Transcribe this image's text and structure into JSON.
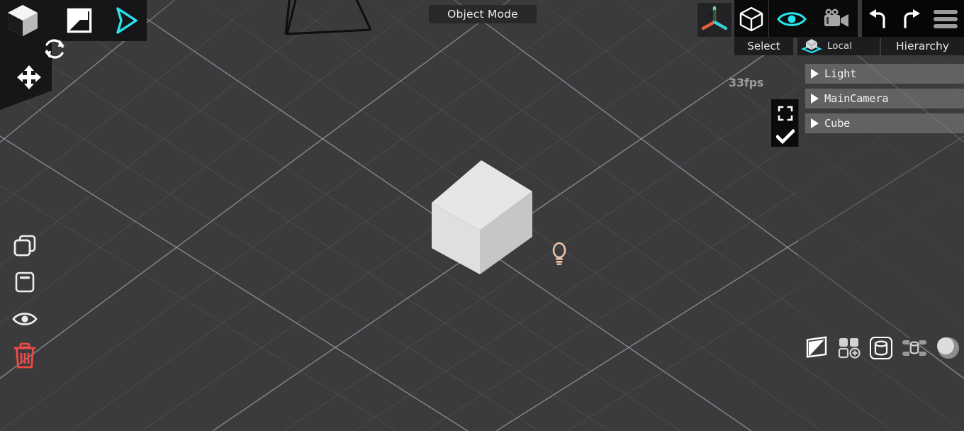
{
  "app": {
    "mode_label": "Object Mode",
    "fps": "33fps"
  },
  "colors": {
    "viewport_bg": "#3b3b3d",
    "grid_line": "#8c8c90",
    "panel_dark": "#161618",
    "accent_cyan": "#28e4ef",
    "danger_red": "#f04a46",
    "light_gizmo": "#f0c0a8",
    "axis_x": "#e2603a",
    "axis_y": "#6fd98a",
    "axis_z": "#35cfd6"
  },
  "top_left_toolbar": {
    "items": [
      {
        "name": "cube-3d-icon",
        "label": "3D Object"
      },
      {
        "name": "shading-icon",
        "label": "Shading"
      },
      {
        "name": "cursor-play-icon",
        "label": "Play"
      },
      {
        "name": "rotate-icon",
        "label": "Rotate"
      },
      {
        "name": "move-icon",
        "label": "Move"
      }
    ]
  },
  "left_tool_strip": {
    "items": [
      {
        "name": "duplicate-icon",
        "label": "Duplicate"
      },
      {
        "name": "panel-icon",
        "label": "Panel"
      },
      {
        "name": "eye-icon",
        "label": "Visibility"
      },
      {
        "name": "trash-icon",
        "label": "Delete"
      }
    ]
  },
  "top_right_toolbar": {
    "axis_gizmo_label": "Axis Gizmo",
    "items": [
      {
        "name": "cube-outline-icon",
        "label": "Object"
      },
      {
        "name": "eye-icon",
        "label": "Visibility",
        "active": true
      },
      {
        "name": "movie-camera-icon",
        "label": "Camera"
      },
      {
        "name": "undo-icon",
        "label": "Undo"
      },
      {
        "name": "redo-icon",
        "label": "Redo"
      },
      {
        "name": "hamburger-menu-icon",
        "label": "Menu"
      }
    ]
  },
  "mode_bar": {
    "select_label": "Select",
    "local_label": "Local",
    "hierarchy_label": "Hierarchy"
  },
  "viewport_buttons": {
    "focus_label": "Focus",
    "confirm_label": "Confirm"
  },
  "hierarchy": {
    "title": "Hierarchy",
    "items": [
      {
        "label": "Light",
        "expanded": false
      },
      {
        "label": "MainCamera",
        "expanded": false
      },
      {
        "label": "Cube",
        "expanded": false
      }
    ]
  },
  "bottom_right_toolbar": {
    "items": [
      {
        "name": "shading-triangle-icon",
        "label": "Shading"
      },
      {
        "name": "add-grid-icon",
        "label": "Add Object"
      },
      {
        "name": "primitive-icon",
        "label": "Primitive",
        "active": true
      },
      {
        "name": "layers-icon",
        "label": "Layers"
      },
      {
        "name": "material-sphere-icon",
        "label": "Material"
      }
    ]
  },
  "scene": {
    "objects": [
      {
        "name": "cube",
        "type": "mesh",
        "selected": false
      },
      {
        "name": "light",
        "type": "light"
      },
      {
        "name": "main-camera",
        "type": "camera"
      }
    ]
  }
}
